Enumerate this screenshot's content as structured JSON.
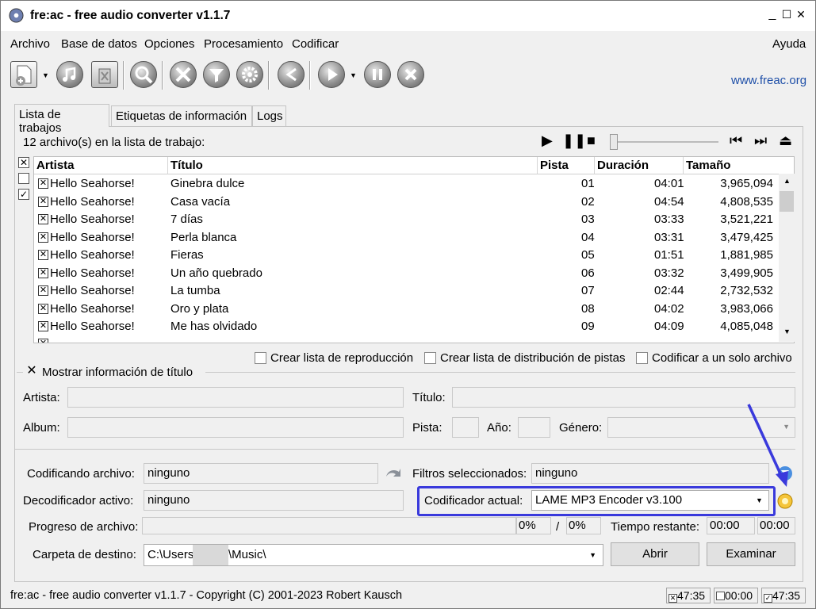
{
  "window": {
    "title": "fre:ac - free audio converter v1.1.7",
    "controls": {
      "minimize": "_",
      "maximize": "☐",
      "close": "✕"
    }
  },
  "menu": {
    "items": [
      "Archivo",
      "Base de datos",
      "Opciones",
      "Procesamiento",
      "Codificar"
    ],
    "help": "Ayuda"
  },
  "toolbar": {
    "link": "www.freac.org"
  },
  "tabs": [
    "Lista de trabajos",
    "Etiquetas de información",
    "Logs"
  ],
  "joblist": {
    "count_text": "12 archivo(s) en la lista de trabajo:",
    "headers": {
      "artist": "Artista",
      "title": "Título",
      "track": "Pista",
      "duration": "Duración",
      "size": "Tamaño"
    },
    "rows": [
      {
        "artist": "Hello Seahorse!",
        "title": "Ginebra dulce",
        "track": "01",
        "duration": "04:01",
        "size": "3,965,094"
      },
      {
        "artist": "Hello Seahorse!",
        "title": "Casa vacía",
        "track": "02",
        "duration": "04:54",
        "size": "4,808,535"
      },
      {
        "artist": "Hello Seahorse!",
        "title": "7 días",
        "track": "03",
        "duration": "03:33",
        "size": "3,521,221"
      },
      {
        "artist": "Hello Seahorse!",
        "title": "Perla blanca",
        "track": "04",
        "duration": "03:31",
        "size": "3,479,425"
      },
      {
        "artist": "Hello Seahorse!",
        "title": "Fieras",
        "track": "05",
        "duration": "01:51",
        "size": "1,881,985"
      },
      {
        "artist": "Hello Seahorse!",
        "title": "Un año quebrado",
        "track": "06",
        "duration": "03:32",
        "size": "3,499,905"
      },
      {
        "artist": "Hello Seahorse!",
        "title": "La tumba",
        "track": "07",
        "duration": "02:44",
        "size": "2,732,532"
      },
      {
        "artist": "Hello Seahorse!",
        "title": "Oro y plata",
        "track": "08",
        "duration": "04:02",
        "size": "3,983,066"
      },
      {
        "artist": "Hello Seahorse!",
        "title": "Me has olvidado",
        "track": "09",
        "duration": "04:09",
        "size": "4,085,048"
      }
    ]
  },
  "options": {
    "playlist": "Crear lista de reproducción",
    "cuesheet": "Crear lista de distribución de pistas",
    "single_file": "Codificar a un solo archivo"
  },
  "titleinfo": {
    "toggle": "Mostrar información de título",
    "artist": "Artista:",
    "title": "Título:",
    "album": "Album:",
    "track": "Pista:",
    "year": "Año:",
    "genre": "Género:"
  },
  "status": {
    "encoding_label": "Codificando archivo:",
    "encoding_value": "ninguno",
    "filters_label": "Filtros seleccionados:",
    "filters_value": "ninguno",
    "decoder_label": "Decodificador activo:",
    "decoder_value": "ninguno",
    "encoder_label": "Codificador actual:",
    "encoder_value": "LAME MP3 Encoder v3.100",
    "progress_label": "Progreso de archivo:",
    "progress_file": "0%",
    "progress_sep": "/",
    "progress_total": "0%",
    "remaining_label": "Tiempo restante:",
    "remaining_file": "00:00",
    "remaining_total": "00:00",
    "output_label": "Carpeta de destino:",
    "output_path_prefix": "C:\\Users\\",
    "output_path_suffix": "\\Music\\",
    "open_button": "Abrir",
    "browse_button": "Examinar"
  },
  "statusbar": {
    "text": "fre:ac - free audio converter v1.1.7 - Copyright (C) 2001-2023 Robert Kausch",
    "t1": "47:35",
    "t2": "00:00",
    "t3": "47:35"
  },
  "colors": {
    "highlight": "#3a3adc",
    "link": "#1e4fa8"
  }
}
